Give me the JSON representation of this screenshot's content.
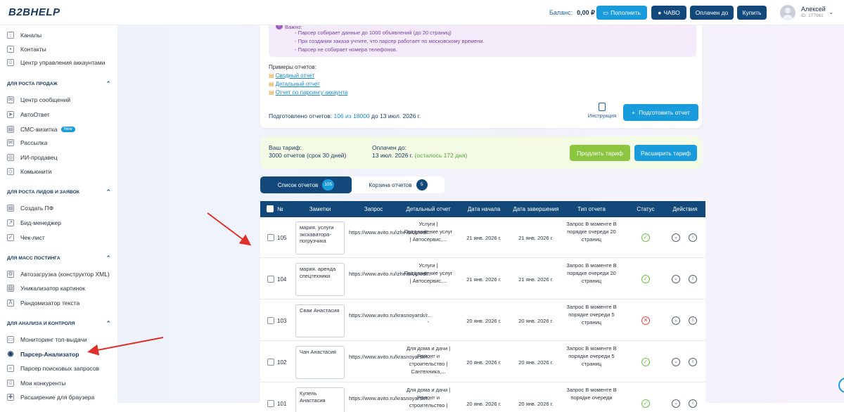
{
  "header": {
    "logo": "B2BHELP",
    "balance_label": "Баланс:",
    "balance_value": "0,00 ₽",
    "buttons": {
      "topup": "Пополнить",
      "faq": "ЧАВО",
      "paid_until": "Оплачен до",
      "buy": "Купить"
    },
    "user_name": "Алексей",
    "user_id": "ID: 177961"
  },
  "sidebar": {
    "items_top": [
      {
        "label": "Каналы"
      },
      {
        "label": "Контакты"
      },
      {
        "label": "Центр управления аккаунтами"
      }
    ],
    "sections": [
      {
        "title": "Для роста продаж",
        "items": [
          {
            "label": "Центр сообщений"
          },
          {
            "label": "АвтоОтвет"
          },
          {
            "label": "СМС-визитка",
            "badge": "New"
          },
          {
            "label": "Рассылка"
          },
          {
            "label": "ИИ-продавец"
          },
          {
            "label": "Комьюнити"
          }
        ]
      },
      {
        "title": "Для роста лидов и заявок",
        "items": [
          {
            "label": "Создать ПФ"
          },
          {
            "label": "Бид-менеджер"
          },
          {
            "label": "Чек-лист"
          }
        ]
      },
      {
        "title": "Для масс постинга",
        "items": [
          {
            "label": "Автозагрузка (конструктор XML)"
          },
          {
            "label": "Уникализатор картинок"
          },
          {
            "label": "Рандомизатор текста"
          }
        ]
      },
      {
        "title": "Для анализа и контроля",
        "items": [
          {
            "label": "Мониторинг топ-выдачи"
          },
          {
            "label": "Парсер-Анализатор",
            "active": true
          },
          {
            "label": "Парсер поисковых запросов"
          },
          {
            "label": "Мои конкуренты"
          },
          {
            "label": "Расширение для браузера"
          }
        ]
      }
    ]
  },
  "notice": {
    "title": "Важно:",
    "lines": [
      "- Парсер собирает данные до 1000 объявлений (до 20 страниц)",
      "- При создании заказа учтите, что парсер работает по московскому времени.",
      "- Парсер не собирает номера телефонов."
    ]
  },
  "examples": {
    "title": "Примеры отчетов:",
    "links": [
      "Сводный отчет",
      "Детальный отчет",
      "Отчет по парсингу аккаунта"
    ]
  },
  "prepared": {
    "prefix": "Подготовлено отчетов:",
    "value": "106 из 18000",
    "suffix": "до 13 июл. 2026 г."
  },
  "instruction_label": "Инструкция",
  "prepare_button": "Подготовить отчет",
  "tariff": {
    "label": "Ваш тариф:",
    "value": "3000 отчетов (срок 30 дней)",
    "paid_label": "Оплачен до:",
    "paid_value": "13 июл. 2026 г.",
    "remaining": "(осталось 172 дня)",
    "extend_button": "Продлить тариф",
    "expand_button": "Расширить тариф"
  },
  "tabs": [
    {
      "label": "Список отчетов",
      "count": "105"
    },
    {
      "label": "Корзина отчетов",
      "count": "5"
    }
  ],
  "table": {
    "headers": [
      "№",
      "Заметки",
      "Запрос",
      "Детальный отчет",
      "Дата начала",
      "Дата завершения",
      "Тип отчета",
      "Статус",
      "Действия"
    ],
    "rows": [
      {
        "num": "105",
        "note": "мария. услуги экскаватора-погрузчика",
        "request": "https://www.avito.ru/izhevsk/predl...",
        "detail": "Услуги | Предложение услуг | Автосервис,...",
        "start": "21 янв. 2026 г.",
        "end": "21 янв. 2026 г.",
        "type": "Запрос В моменте В порядке очереди 20 страниц",
        "status": "ok"
      },
      {
        "num": "104",
        "note": "мария. аренда спецтехники",
        "request": "https://www.avito.ru/izhevsk/predl...",
        "detail": "Услуги | Предложение услуг | Автосервис,...",
        "start": "21 янв. 2026 г.",
        "end": "21 янв. 2026 г.",
        "type": "Запрос В моменте В порядке очереди 20 страниц",
        "status": "ok"
      },
      {
        "num": "103",
        "note": "Сваи Анастасия",
        "request": "https://www.avito.ru/krasnoyarsk/r...",
        "detail": "-",
        "start": "20 янв. 2026 г.",
        "end": "20 янв. 2026 г.",
        "type": "Запрос В моменте В порядке очереди 5 страниц",
        "status": "error"
      },
      {
        "num": "102",
        "note": "Чан Анастасия",
        "request": "https://www.avito.ru/krasnoyarsk/r...",
        "detail": "Для дома и дачи | Ремонт и строительство | Сантехника,...",
        "start": "20 янв. 2026 г.",
        "end": "20 янв. 2026 г.",
        "type": "Запрос В моменте В порядке очереди 5 страниц",
        "status": "ok"
      },
      {
        "num": "101",
        "note": "Купель Анастасия",
        "request": "https://www.avito.ru/krasnoyarsk/r...",
        "detail": "Для дома и дачи | Ремонт и строительство |",
        "start": "20 янв. 2026 г.",
        "end": "20 янв. 2026 г.",
        "type": "Запрос В моменте В порядке очереди",
        "status": "ok"
      }
    ]
  }
}
